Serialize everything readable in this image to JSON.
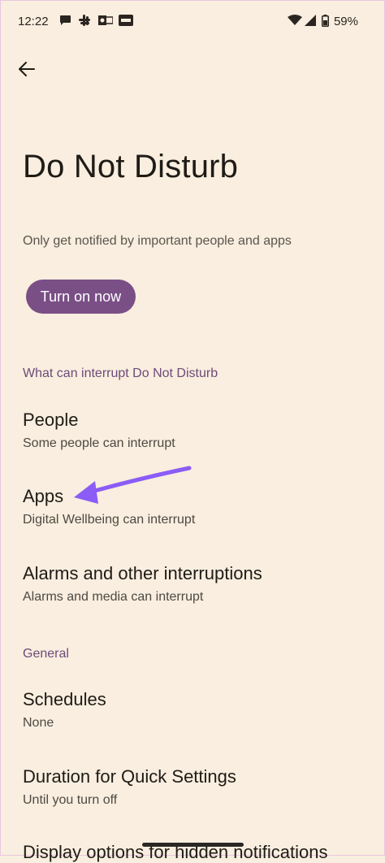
{
  "status_bar": {
    "time": "12:22",
    "battery": "59%",
    "icons": [
      "messages-icon",
      "slack-icon",
      "outlook-icon",
      "paytm-icon",
      "wifi-icon",
      "signal-icon",
      "battery-icon"
    ]
  },
  "page": {
    "title": "Do Not Disturb",
    "subtitle": "Only get notified by important people and apps",
    "turn_on_label": "Turn on now"
  },
  "sections": {
    "interrupt_header": "What can interrupt Do Not Disturb",
    "general_header": "General"
  },
  "items": {
    "people": {
      "title": "People",
      "subtitle": "Some people can interrupt"
    },
    "apps": {
      "title": "Apps",
      "subtitle": "Digital Wellbeing can interrupt"
    },
    "alarms": {
      "title": "Alarms and other interruptions",
      "subtitle": "Alarms and media can interrupt"
    },
    "schedules": {
      "title": "Schedules",
      "subtitle": "None"
    },
    "duration": {
      "title": "Duration for Quick Settings",
      "subtitle": "Until you turn off"
    },
    "display_options": {
      "title": "Display options for hidden notifications"
    }
  },
  "colors": {
    "background": "#f9eedf",
    "accent": "#7a4f86",
    "section_header": "#6d4a7a",
    "annotation_arrow": "#8b5cf6"
  }
}
